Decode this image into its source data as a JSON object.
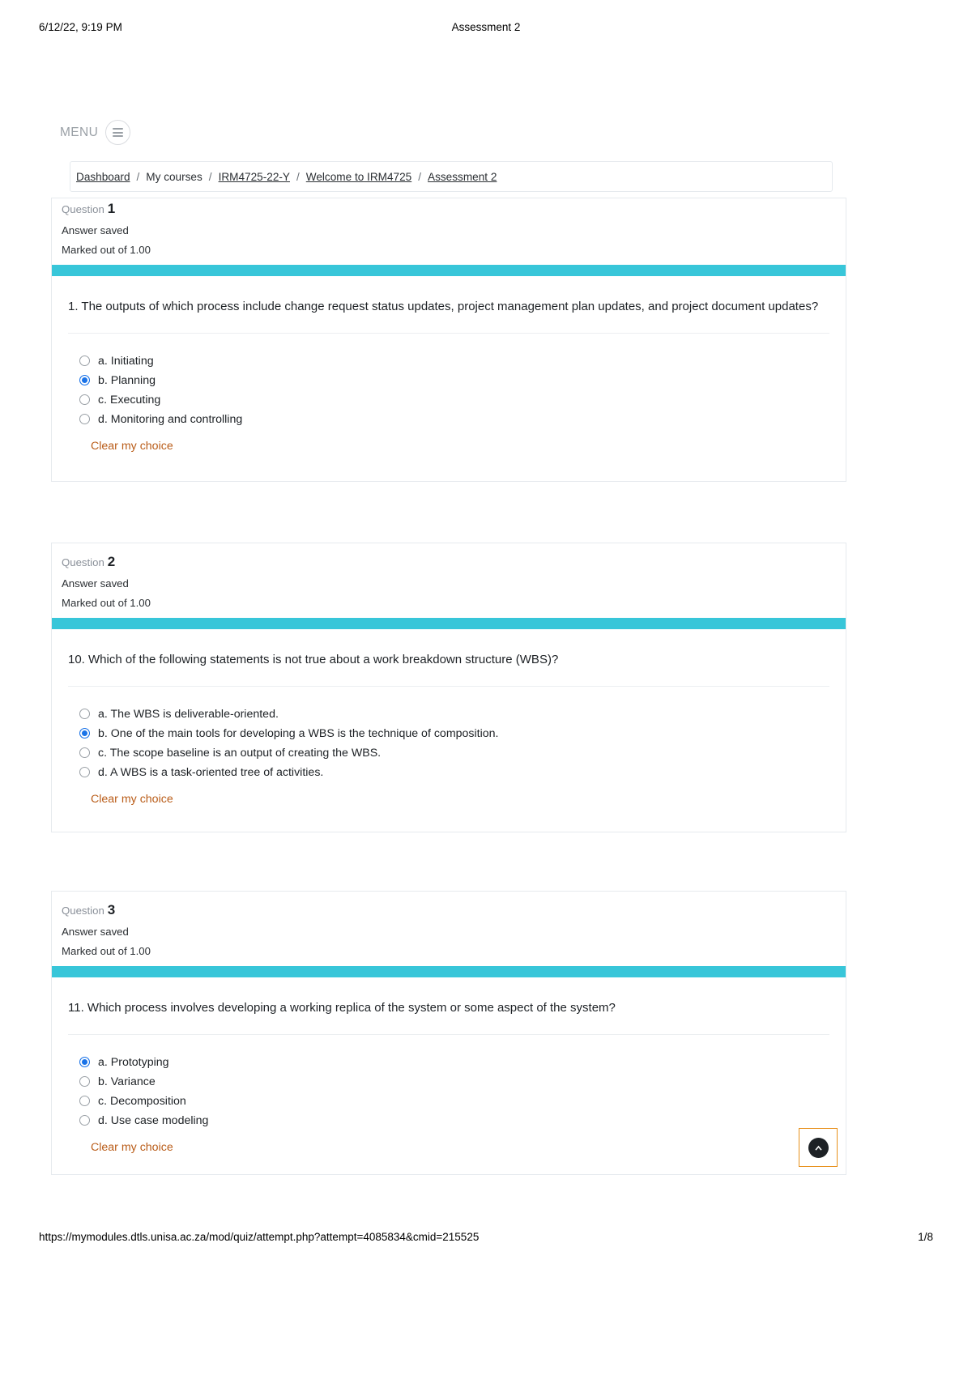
{
  "print": {
    "date": "6/12/22, 9:19 PM",
    "title": "Assessment 2",
    "url": "https://mymodules.dtls.unisa.ac.za/mod/quiz/attempt.php?attempt=4085834&cmid=215525",
    "page": "1/8"
  },
  "nav": {
    "menu_label": "MENU",
    "menu_icon": "hamburger-icon"
  },
  "breadcrumb": {
    "separator": "/",
    "items": [
      {
        "label": "Dashboard",
        "is_link": true
      },
      {
        "label": "My courses",
        "is_link": false
      },
      {
        "label": "IRM4725-22-Y",
        "is_link": true
      },
      {
        "label": "Welcome to IRM4725",
        "is_link": true
      },
      {
        "label": "Assessment 2",
        "is_link": true
      }
    ]
  },
  "labels": {
    "question_word": "Question",
    "clear_choice": "Clear my choice",
    "back_to_top_icon": "chevron-up-icon"
  },
  "colors": {
    "accent_bar": "#38c6d9",
    "link_orange": "#b95c18",
    "radio_selected": "#1a73e8",
    "back_to_top_border": "#e8911c"
  },
  "questions": [
    {
      "number": "1",
      "status": "Answer saved",
      "marks": "Marked out of 1.00",
      "text": "1. The outputs of which process include change request status updates, project management plan updates, and project document updates?",
      "options": [
        {
          "label": "a. Initiating",
          "selected": false
        },
        {
          "label": "b. Planning",
          "selected": true
        },
        {
          "label": "c. Executing",
          "selected": false
        },
        {
          "label": "d. Monitoring and controlling",
          "selected": false
        }
      ]
    },
    {
      "number": "2",
      "status": "Answer saved",
      "marks": "Marked out of 1.00",
      "text": "10. Which of the following statements is not true about a work breakdown structure (WBS)?",
      "options": [
        {
          "label": "a. The WBS is deliverable-oriented.",
          "selected": false
        },
        {
          "label": "b. One of the main tools for developing a WBS is the technique of composition.",
          "selected": true
        },
        {
          "label": "c. The scope baseline is an output of creating the WBS.",
          "selected": false
        },
        {
          "label": "d. A WBS is a task-oriented tree of activities.",
          "selected": false
        }
      ]
    },
    {
      "number": "3",
      "status": "Answer saved",
      "marks": "Marked out of 1.00",
      "text": "11. Which process involves developing a working replica of the system or some aspect of the system?",
      "options": [
        {
          "label": "a. Prototyping",
          "selected": true
        },
        {
          "label": "b. Variance",
          "selected": false
        },
        {
          "label": "c. Decomposition",
          "selected": false
        },
        {
          "label": "d. Use case modeling",
          "selected": false
        }
      ]
    }
  ]
}
